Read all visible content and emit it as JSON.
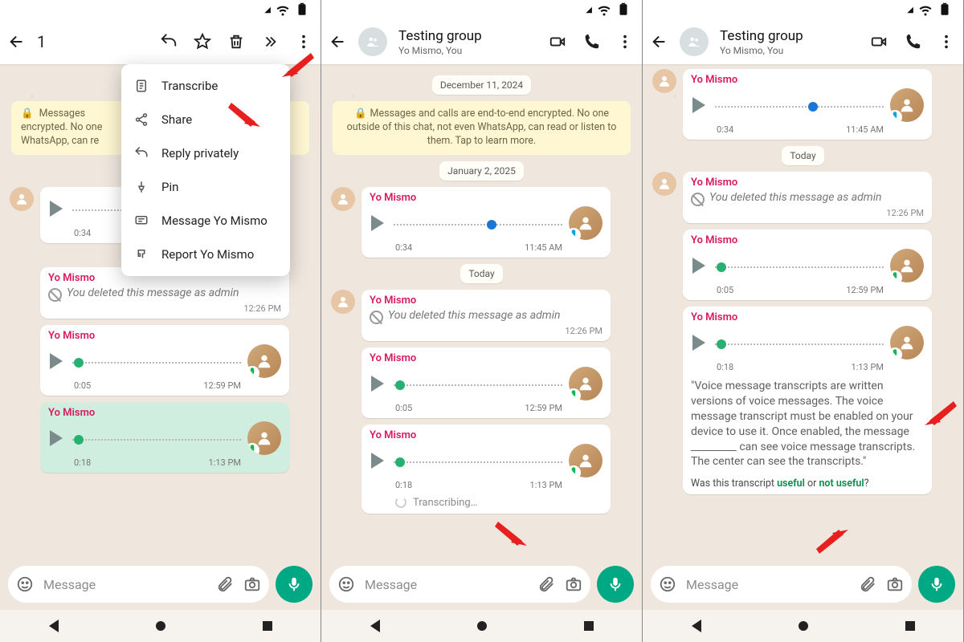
{
  "status": {
    "wifi": true,
    "battery": true
  },
  "colors": {
    "accent": "#00a884",
    "sender": "#d81b60",
    "link": "#098a4c"
  },
  "header_sel": {
    "count": "1"
  },
  "header_grp": {
    "title": "Testing group",
    "subtitle": "Yo Mismo, You"
  },
  "menu": {
    "transcribe": "Transcribe",
    "share": "Share",
    "reply_priv": "Reply privately",
    "pin": "Pin",
    "message_user": "Message Yo Mismo",
    "report_user": "Report Yo Mismo"
  },
  "dates": {
    "dec11": "December 11, 2024",
    "jan2": "January 2, 2025",
    "today": "Today"
  },
  "encryption": "Messages and calls are end-to-end encrypted. No one outside of this chat, not even WhatsApp, can read or listen to them. Tap to learn more.",
  "sender_name": "Yo Mismo",
  "voice1": {
    "duration": "0:34",
    "time": "11:45 AM"
  },
  "deleted": {
    "text": "You deleted this message as admin",
    "time": "12:26 PM"
  },
  "voice2": {
    "duration": "0:05",
    "time": "12:59 PM"
  },
  "voice3": {
    "duration": "0:18",
    "time": "1:13 PM"
  },
  "transcribing": "Transcribing…",
  "transcript": "\"Voice message transcripts are written versions of voice messages. The voice message transcript must be enabled on your device to use it. Once enabled, the message _________ can see voice message transcripts. The center can see the transcripts.\"",
  "feedback": {
    "q": "Was this transcript ",
    "useful": "useful",
    "or": " or ",
    "not_useful": "not useful",
    "end": "?"
  },
  "composer": {
    "placeholder": "Message"
  }
}
